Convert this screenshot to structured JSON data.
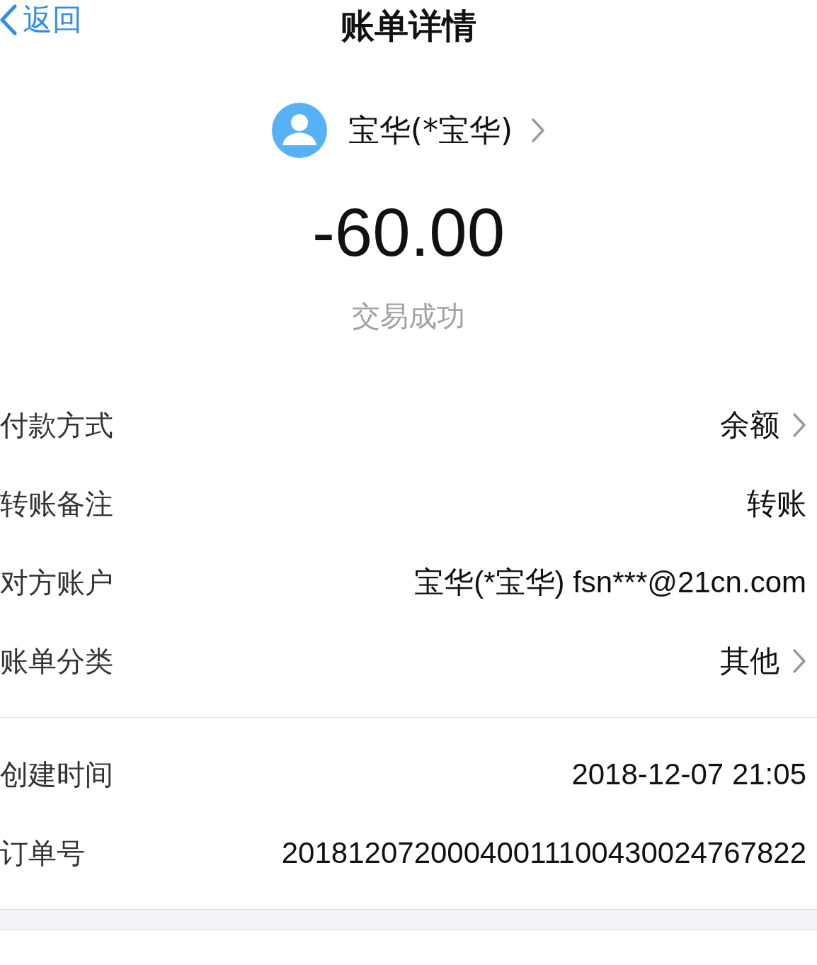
{
  "nav": {
    "back": "返回",
    "title": "账单详情"
  },
  "payee": {
    "name": "宝华(*宝华)",
    "has_link": true
  },
  "amount": "-60.00",
  "status": "交易成功",
  "groups": [
    {
      "rows": [
        {
          "label": "付款方式",
          "value": "余额",
          "has_link": true
        },
        {
          "label": "转账备注",
          "value": "转账",
          "has_link": false
        },
        {
          "label": "对方账户",
          "value": "宝华(*宝华) fsn***@21cn.com",
          "has_link": false
        },
        {
          "label": "账单分类",
          "value": "其他",
          "has_link": true
        }
      ]
    },
    {
      "rows": [
        {
          "label": "创建时间",
          "value": "2018-12-07 21:05",
          "has_link": false
        },
        {
          "label": "订单号",
          "value": "20181207200040011100430024767822",
          "has_link": false
        }
      ]
    }
  ]
}
